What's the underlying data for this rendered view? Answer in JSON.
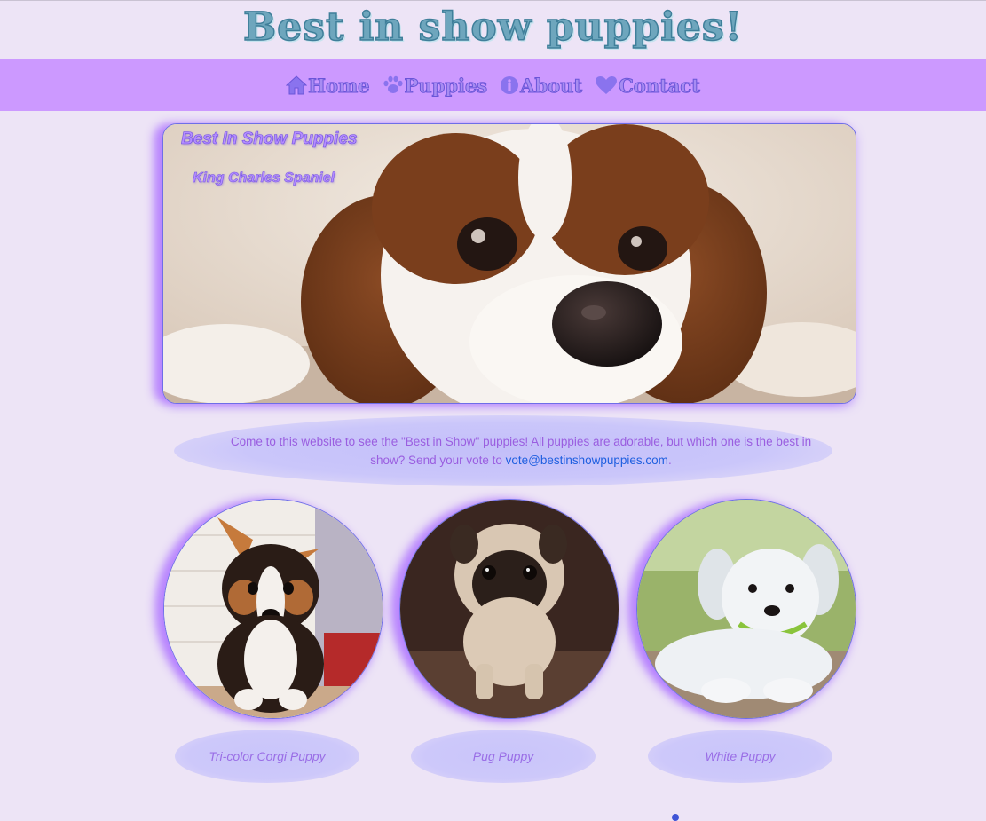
{
  "site_title": "Best in show puppies!",
  "nav": {
    "items": [
      {
        "label": "Home",
        "icon": "home-icon"
      },
      {
        "label": "Puppies",
        "icon": "paw-icon"
      },
      {
        "label": "About",
        "icon": "info-icon"
      },
      {
        "label": "Contact",
        "icon": "heart-icon"
      }
    ]
  },
  "hero": {
    "title": "Best In Show Puppies",
    "subtitle": "King Charles Spaniel"
  },
  "intro": {
    "text": "Come to this website to see the \"Best in Show\" puppies! All puppies are adorable, but which one is the best in show? Send your vote to ",
    "email": "vote@bestinshowpuppies.com",
    "suffix": "."
  },
  "puppies": [
    {
      "caption": "Tri-color Corgi Puppy"
    },
    {
      "caption": "Pug Puppy"
    },
    {
      "caption": "White Puppy"
    }
  ],
  "colors": {
    "background": "#ede4f6",
    "navbar": "#cc99ff",
    "accent": "#b48cff",
    "border": "#6e6ee8"
  }
}
